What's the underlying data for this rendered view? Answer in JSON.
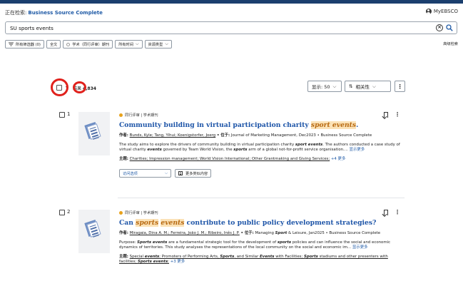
{
  "header": {
    "searching_label": "正在检索:",
    "database": "Business Source Complete",
    "account": "MyEBSCO"
  },
  "search": {
    "query": "SU sports events"
  },
  "filters": {
    "all_filters": "所有筛选器 (0)",
    "full_text": "全文",
    "peer_reviewed": "学术（同行评审）期刊",
    "all_time": "所有时间",
    "source_type": "资源类型",
    "advanced": "高级检索"
  },
  "results_bar": {
    "result_label": "结果",
    "result_count": "4,834",
    "show_label": "显示: 50",
    "sort_label": "相关性"
  },
  "results": [
    {
      "number": "1",
      "type": "同行评审 | 学术期刊",
      "title_parts": [
        "Community building in virtual participation charity ",
        "sport events",
        "."
      ],
      "authors_label": "作者:",
      "authors": "Bunds, Kyle; Tang, Yihui; Koenigstorfer, Joerg",
      "venue_label": "• 位于:",
      "venue": "Journal of Marketing Management, Dec2023 • Business Source Complete",
      "abstract_parts": [
        "The study aims to explore the drivers of community building in virtual participation charity ",
        "sport events",
        ". The authors conducted a case study of virtual charity ",
        "events",
        " governed by Team World Vision, the ",
        "sports",
        " arm of a global not-for-profit service organisation.... "
      ],
      "show_more": "显示更多",
      "subjects_label": "主题:",
      "subjects": "Charities; Impression management; World Vision International; Other Grantmaking and Giving Services;",
      "subjects_more": "+4 更多",
      "access_label": "访问选项",
      "similar_label": "更多类似内容"
    },
    {
      "number": "2",
      "type": "同行评审 | 学术期刊",
      "title_parts": [
        "Can ",
        "sports",
        " ",
        "events",
        " contribute to public policy development strategies?"
      ],
      "authors_label": "作者:",
      "authors": "Miragaia, Dina A. M.; Ferreira, João J. M.; Ribeiro, Inês J. P.",
      "venue_label": "• 位于:",
      "venue_parts": [
        "Managing ",
        "Sport",
        " & Leisure, Jan2025 • Business Source Complete"
      ],
      "abstract_parts": [
        "Purpose: ",
        "Sports events",
        " are a fundamental strategic tool for the development of ",
        "sports",
        " policies and can influence the social and economic dynamics of territories. This study analyses the representations of the local community on the social and economic im... "
      ],
      "show_more": "显示更多",
      "subjects_label": "主题:",
      "subjects_parts": [
        "Special ",
        "events",
        "; Promoters of Performing Arts, ",
        "Sports",
        ", and Similar ",
        "Events",
        " with Facilities; ",
        "Sports",
        " stadiums and other presenters with facilities; ",
        "Sports events",
        ";"
      ],
      "subjects_more": "+3 更多"
    }
  ],
  "annotations": {
    "color": "#e0211c"
  }
}
